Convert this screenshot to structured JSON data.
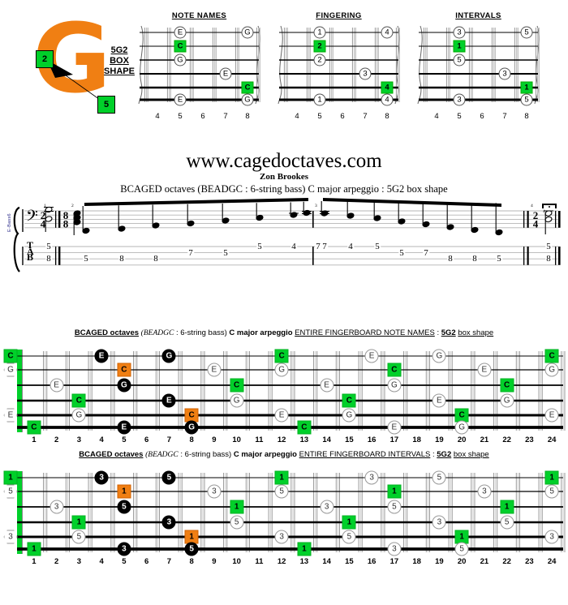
{
  "logo": {
    "letter": "G",
    "tag_top": "2",
    "tag_bottom": "5",
    "box_line1": "5G2",
    "box_line2": "BOX",
    "box_line3": "SHAPE",
    "orange": "#F07F13",
    "green": "#00D02A"
  },
  "header": {
    "site": "www.cagedoctaves.com",
    "author": "Zon Brookes",
    "subtitle": "BCAGED octaves (BEADGC : 6-string bass) C major arpeggio : 5G2 box shape"
  },
  "box_diagrams": [
    {
      "id": "notenames",
      "title": "NOTE NAMES",
      "frets": [
        "4",
        "5",
        "6",
        "7",
        "8"
      ],
      "markers": [
        {
          "string": 1,
          "fret": 5,
          "label": "E",
          "style": "circle"
        },
        {
          "string": 1,
          "fret": 8,
          "label": "G",
          "style": "circle"
        },
        {
          "string": 2,
          "fret": 5,
          "label": "C",
          "style": "green"
        },
        {
          "string": 3,
          "fret": 5,
          "label": "G",
          "style": "circle"
        },
        {
          "string": 4,
          "fret": 7,
          "label": "E",
          "style": "circle"
        },
        {
          "string": 5,
          "fret": 8,
          "label": "C",
          "style": "green"
        },
        {
          "string": 6,
          "fret": 5,
          "label": "E",
          "style": "circle"
        },
        {
          "string": 6,
          "fret": 8,
          "label": "G",
          "style": "circle"
        }
      ]
    },
    {
      "id": "fingering",
      "title": "FINGERING",
      "frets": [
        "4",
        "5",
        "6",
        "7",
        "8"
      ],
      "markers": [
        {
          "string": 1,
          "fret": 5,
          "label": "1",
          "style": "circle"
        },
        {
          "string": 1,
          "fret": 8,
          "label": "4",
          "style": "circle"
        },
        {
          "string": 2,
          "fret": 5,
          "label": "2",
          "style": "green"
        },
        {
          "string": 3,
          "fret": 5,
          "label": "2",
          "style": "circle"
        },
        {
          "string": 4,
          "fret": 7,
          "label": "3",
          "style": "circle"
        },
        {
          "string": 5,
          "fret": 8,
          "label": "4",
          "style": "green"
        },
        {
          "string": 6,
          "fret": 5,
          "label": "1",
          "style": "circle"
        },
        {
          "string": 6,
          "fret": 8,
          "label": "4",
          "style": "circle"
        }
      ]
    },
    {
      "id": "intervals",
      "title": "INTERVALS",
      "frets": [
        "4",
        "5",
        "6",
        "7",
        "8"
      ],
      "markers": [
        {
          "string": 1,
          "fret": 5,
          "label": "3",
          "style": "circle"
        },
        {
          "string": 1,
          "fret": 8,
          "label": "5",
          "style": "circle"
        },
        {
          "string": 2,
          "fret": 5,
          "label": "1",
          "style": "green"
        },
        {
          "string": 3,
          "fret": 5,
          "label": "5",
          "style": "circle"
        },
        {
          "string": 4,
          "fret": 7,
          "label": "3",
          "style": "circle"
        },
        {
          "string": 5,
          "fret": 8,
          "label": "1",
          "style": "green"
        },
        {
          "string": 6,
          "fret": 5,
          "label": "3",
          "style": "circle"
        },
        {
          "string": 6,
          "fret": 8,
          "label": "5",
          "style": "circle"
        }
      ]
    }
  ],
  "notation": {
    "side_label": "E-Bass6",
    "clef": "bass",
    "time_signature_start": "2/4",
    "time_signature_mid": "8/8",
    "time_signature_end": "2/4",
    "tab_letters": [
      "T",
      "A",
      "B"
    ],
    "measure_numbers": [
      "1",
      "2",
      "3",
      "4"
    ],
    "pickup_tab": [
      {
        "string": 1,
        "fret": "5"
      },
      {
        "string": 3,
        "fret": "8"
      }
    ],
    "ascending_tab": [
      {
        "string": 3,
        "fret": "5"
      },
      {
        "string": 3,
        "fret": "8"
      },
      {
        "string": 3,
        "fret": "8"
      },
      {
        "string": 2,
        "fret": "7"
      },
      {
        "string": 2,
        "fret": "5"
      },
      {
        "string": 1,
        "fret": "5"
      },
      {
        "string": 1,
        "fret": "4"
      },
      {
        "string": 1,
        "fret": "7"
      }
    ],
    "descending_tab": [
      {
        "string": 1,
        "fret": "7"
      },
      {
        "string": 1,
        "fret": "4"
      },
      {
        "string": 1,
        "fret": "5"
      },
      {
        "string": 2,
        "fret": "5"
      },
      {
        "string": 2,
        "fret": "7"
      },
      {
        "string": 3,
        "fret": "8"
      },
      {
        "string": 3,
        "fret": "8"
      },
      {
        "string": 3,
        "fret": "5"
      }
    ],
    "final_tab": [
      {
        "string": 1,
        "fret": "5"
      },
      {
        "string": 3,
        "fret": "8"
      }
    ]
  },
  "fretboards": [
    {
      "id": "notenames",
      "title_a": "BCAGED octaves",
      "title_b": "(BEADGC",
      "title_c": ": 6-string bass)",
      "title_d": "C major arpeggio",
      "title_e": "ENTIRE FINGERBOARD   NOTE NAMES",
      "title_f": ":",
      "title_g": "5G2",
      "title_h": "box shape",
      "frets": [
        "1",
        "2",
        "3",
        "4",
        "5",
        "6",
        "7",
        "8",
        "9",
        "10",
        "11",
        "12",
        "13",
        "14",
        "15",
        "16",
        "17",
        "18",
        "19",
        "20",
        "21",
        "22",
        "23",
        "24"
      ],
      "open_strings": [
        {
          "string": 1,
          "label": "C",
          "style": "g"
        },
        {
          "string": 2,
          "label": "G",
          "style": "hex"
        },
        {
          "string": 5,
          "label": "E",
          "style": "hex"
        }
      ],
      "markers": [
        {
          "string": 6,
          "fret": 1,
          "label": "C",
          "style": "g"
        },
        {
          "string": 4,
          "fret": 3,
          "label": "C",
          "style": "g"
        },
        {
          "string": 3,
          "fret": 2,
          "label": "E",
          "style": "w"
        },
        {
          "string": 5,
          "fret": 3,
          "label": "G",
          "style": "w"
        },
        {
          "string": 1,
          "fret": 4,
          "label": "E",
          "style": "k"
        },
        {
          "string": 2,
          "fret": 5,
          "label": "C",
          "style": "o"
        },
        {
          "string": 3,
          "fret": 5,
          "label": "G",
          "style": "k"
        },
        {
          "string": 6,
          "fret": 5,
          "label": "E",
          "style": "k"
        },
        {
          "string": 1,
          "fret": 7,
          "label": "G",
          "style": "k"
        },
        {
          "string": 4,
          "fret": 7,
          "label": "E",
          "style": "k"
        },
        {
          "string": 5,
          "fret": 8,
          "label": "C",
          "style": "o"
        },
        {
          "string": 6,
          "fret": 8,
          "label": "G",
          "style": "k"
        },
        {
          "string": 2,
          "fret": 9,
          "label": "E",
          "style": "w"
        },
        {
          "string": 3,
          "fret": 10,
          "label": "C",
          "style": "g"
        },
        {
          "string": 4,
          "fret": 10,
          "label": "G",
          "style": "w"
        },
        {
          "string": 1,
          "fret": 12,
          "label": "C",
          "style": "g"
        },
        {
          "string": 2,
          "fret": 12,
          "label": "G",
          "style": "w"
        },
        {
          "string": 5,
          "fret": 12,
          "label": "E",
          "style": "w"
        },
        {
          "string": 6,
          "fret": 13,
          "label": "C",
          "style": "g"
        },
        {
          "string": 3,
          "fret": 14,
          "label": "E",
          "style": "w"
        },
        {
          "string": 4,
          "fret": 15,
          "label": "C",
          "style": "g"
        },
        {
          "string": 5,
          "fret": 15,
          "label": "G",
          "style": "w"
        },
        {
          "string": 1,
          "fret": 16,
          "label": "E",
          "style": "w"
        },
        {
          "string": 2,
          "fret": 17,
          "label": "C",
          "style": "g"
        },
        {
          "string": 3,
          "fret": 17,
          "label": "G",
          "style": "w"
        },
        {
          "string": 6,
          "fret": 17,
          "label": "E",
          "style": "w"
        },
        {
          "string": 1,
          "fret": 19,
          "label": "G",
          "style": "w"
        },
        {
          "string": 4,
          "fret": 19,
          "label": "E",
          "style": "w"
        },
        {
          "string": 5,
          "fret": 20,
          "label": "C",
          "style": "g"
        },
        {
          "string": 6,
          "fret": 20,
          "label": "G",
          "style": "w"
        },
        {
          "string": 2,
          "fret": 21,
          "label": "E",
          "style": "w"
        },
        {
          "string": 3,
          "fret": 22,
          "label": "C",
          "style": "g"
        },
        {
          "string": 4,
          "fret": 22,
          "label": "G",
          "style": "w"
        },
        {
          "string": 1,
          "fret": 24,
          "label": "C",
          "style": "g"
        },
        {
          "string": 2,
          "fret": 24,
          "label": "G",
          "style": "w"
        },
        {
          "string": 5,
          "fret": 24,
          "label": "E",
          "style": "w"
        }
      ]
    },
    {
      "id": "intervals",
      "title_a": "BCAGED octaves",
      "title_b": "(BEADGC",
      "title_c": ": 6-string bass)",
      "title_d": "C major arpeggio",
      "title_e": "ENTIRE FINGERBOARD   INTERVALS",
      "title_f": ":",
      "title_g": "5G2",
      "title_h": "box shape",
      "frets": [
        "1",
        "2",
        "3",
        "4",
        "5",
        "6",
        "7",
        "8",
        "9",
        "10",
        "11",
        "12",
        "13",
        "14",
        "15",
        "16",
        "17",
        "18",
        "19",
        "20",
        "21",
        "22",
        "23",
        "24"
      ],
      "open_strings": [
        {
          "string": 1,
          "label": "1",
          "style": "g"
        },
        {
          "string": 2,
          "label": "5",
          "style": "hex"
        },
        {
          "string": 5,
          "label": "3",
          "style": "hex"
        }
      ],
      "markers": [
        {
          "string": 6,
          "fret": 1,
          "label": "1",
          "style": "g"
        },
        {
          "string": 4,
          "fret": 3,
          "label": "1",
          "style": "g"
        },
        {
          "string": 3,
          "fret": 2,
          "label": "3",
          "style": "w"
        },
        {
          "string": 5,
          "fret": 3,
          "label": "5",
          "style": "w"
        },
        {
          "string": 1,
          "fret": 4,
          "label": "3",
          "style": "k"
        },
        {
          "string": 2,
          "fret": 5,
          "label": "1",
          "style": "o"
        },
        {
          "string": 3,
          "fret": 5,
          "label": "5",
          "style": "k"
        },
        {
          "string": 6,
          "fret": 5,
          "label": "3",
          "style": "k"
        },
        {
          "string": 1,
          "fret": 7,
          "label": "5",
          "style": "k"
        },
        {
          "string": 4,
          "fret": 7,
          "label": "3",
          "style": "k"
        },
        {
          "string": 5,
          "fret": 8,
          "label": "1",
          "style": "o"
        },
        {
          "string": 6,
          "fret": 8,
          "label": "5",
          "style": "k"
        },
        {
          "string": 2,
          "fret": 9,
          "label": "3",
          "style": "w"
        },
        {
          "string": 3,
          "fret": 10,
          "label": "1",
          "style": "g"
        },
        {
          "string": 4,
          "fret": 10,
          "label": "5",
          "style": "w"
        },
        {
          "string": 1,
          "fret": 12,
          "label": "1",
          "style": "g"
        },
        {
          "string": 2,
          "fret": 12,
          "label": "5",
          "style": "w"
        },
        {
          "string": 5,
          "fret": 12,
          "label": "3",
          "style": "w"
        },
        {
          "string": 6,
          "fret": 13,
          "label": "1",
          "style": "g"
        },
        {
          "string": 3,
          "fret": 14,
          "label": "3",
          "style": "w"
        },
        {
          "string": 4,
          "fret": 15,
          "label": "1",
          "style": "g"
        },
        {
          "string": 5,
          "fret": 15,
          "label": "5",
          "style": "w"
        },
        {
          "string": 1,
          "fret": 16,
          "label": "3",
          "style": "w"
        },
        {
          "string": 2,
          "fret": 17,
          "label": "1",
          "style": "g"
        },
        {
          "string": 3,
          "fret": 17,
          "label": "5",
          "style": "w"
        },
        {
          "string": 6,
          "fret": 17,
          "label": "3",
          "style": "w"
        },
        {
          "string": 1,
          "fret": 19,
          "label": "5",
          "style": "w"
        },
        {
          "string": 4,
          "fret": 19,
          "label": "3",
          "style": "w"
        },
        {
          "string": 5,
          "fret": 20,
          "label": "1",
          "style": "g"
        },
        {
          "string": 6,
          "fret": 20,
          "label": "5",
          "style": "w"
        },
        {
          "string": 2,
          "fret": 21,
          "label": "3",
          "style": "w"
        },
        {
          "string": 3,
          "fret": 22,
          "label": "1",
          "style": "g"
        },
        {
          "string": 4,
          "fret": 22,
          "label": "5",
          "style": "w"
        },
        {
          "string": 1,
          "fret": 24,
          "label": "1",
          "style": "g"
        },
        {
          "string": 2,
          "fret": 24,
          "label": "5",
          "style": "w"
        },
        {
          "string": 5,
          "fret": 24,
          "label": "3",
          "style": "w"
        }
      ]
    }
  ]
}
